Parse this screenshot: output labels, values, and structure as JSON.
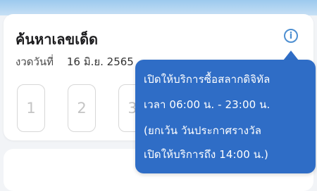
{
  "card": {
    "title": "ค้นหาเลขเด็ด",
    "draw_label": "งวดวันที่",
    "draw_date": "16 มิ.ย. 2565",
    "info_icon": "info-icon"
  },
  "digits": [
    "1",
    "2",
    "3"
  ],
  "tooltip": {
    "lines": [
      "เปิดให้บริการซื้อสลากดิจิทัล",
      "เวลา 06:00 น.  -  23:00 น.",
      "(ยกเว้น  วันประกาศรางวัล",
      "เปิดให้บริการถึง  14:00  น.)"
    ]
  },
  "colors": {
    "tooltip_bg": "#2f6dc6",
    "accent": "#4e8fd1"
  }
}
